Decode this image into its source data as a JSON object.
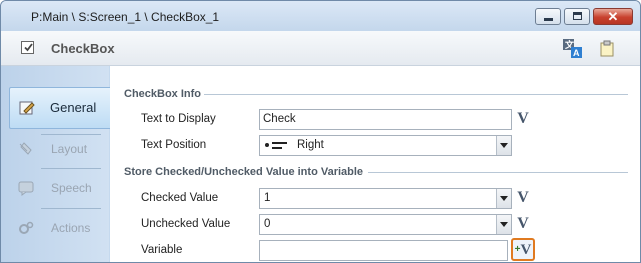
{
  "window": {
    "title": "P:Main \\ S:Screen_1 \\ CheckBox_1",
    "minimize_icon": "minimize-icon",
    "maximize_icon": "maximize-icon",
    "close_icon": "close-icon",
    "close_color": "#c8412e"
  },
  "header": {
    "title": "CheckBox",
    "icons": [
      "checkbox-icon",
      "translate-icon",
      "note-icon"
    ]
  },
  "sidebar": {
    "items": [
      {
        "label": "General",
        "icon": "general-icon",
        "active": true
      },
      {
        "label": "Layout",
        "icon": "layout-icon",
        "active": false
      },
      {
        "label": "Speech",
        "icon": "speech-icon",
        "active": false
      },
      {
        "label": "Actions",
        "icon": "actions-icon",
        "active": false
      }
    ]
  },
  "content": {
    "section1": {
      "title": "CheckBox Info",
      "text_to_display_label": "Text to Display",
      "text_to_display_value": "Check",
      "text_position_label": "Text Position",
      "text_position_value": "Right"
    },
    "section2": {
      "title": "Store Checked/Unchecked Value into Variable",
      "checked_value_label": "Checked Value",
      "checked_value": "1",
      "unchecked_value_label": "Unchecked Value",
      "unchecked_value": "0",
      "variable_label": "Variable",
      "variable_value": ""
    },
    "variable_button_glyph": "V",
    "add_variable_plus": "+",
    "highlight_color": "#e07a20"
  }
}
